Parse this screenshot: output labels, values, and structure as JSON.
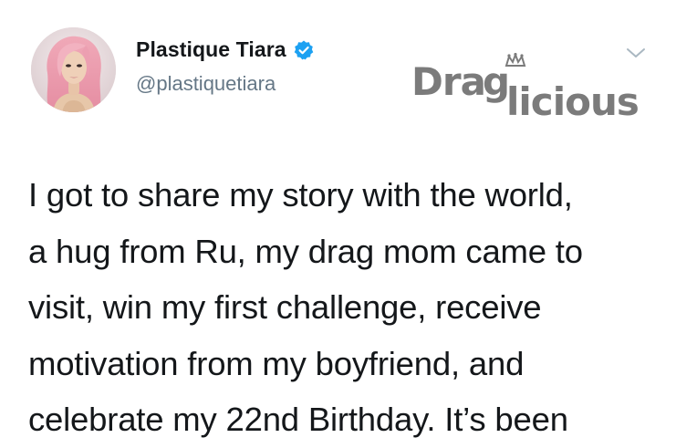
{
  "tweet": {
    "author": {
      "display_name": "Plastique Tiara",
      "handle": "@plastiquetiara",
      "verified": true
    },
    "watermark": {
      "text": "Draglicious",
      "color": "#7b7b7b"
    },
    "menu_icon": "chevron-down-icon",
    "body_lines": [
      "I got to share my story with the world,",
      "a hug from Ru, my drag mom came to",
      "visit, win my first challenge, receive",
      "motivation from my boyfriend, and",
      "celebrate my 22nd Birthday. It’s been"
    ]
  },
  "colors": {
    "verified_badge": "#1da1f2",
    "handle": "#657786",
    "text": "#14171a",
    "caret": "#aab8c2"
  }
}
